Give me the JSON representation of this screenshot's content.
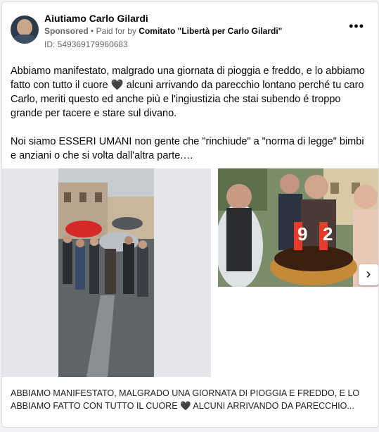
{
  "post": {
    "page_name": "Aiutiamo Carlo Gilardi",
    "sponsored_label": "Sponsored",
    "separator": "•",
    "paid_for_by": "Paid for by",
    "sponsor": "Comitato \"Libertà per Carlo Gilardi\"",
    "ad_id": "ID: 549369179960683",
    "more_icon": "more-options-icon",
    "body_paragraphs": [
      "Abbiamo manifestato, malgrado una giornata di pioggia e freddo, e lo abbiamo fatto con tutto il cuore 🖤 alcuni arrivando da parecchio lontano perché tu caro Carlo, meriti questo ed anche più e l'ingiustizia che stai subendo é troppo grande per tacere e stare sul divano.",
      "Noi siamo ESSERI UMANI non gente che \"rinchiude\" a \"norma di legge\" bimbi e anziani o che si volta dall'altra parte.…"
    ],
    "carousel_next_icon": "chevron-right-icon",
    "caption": "ABBIAMO MANIFESTATO, MALGRADO UNA GIORNATA DI PIOGGIA E FREDDO, E LO ABBIAMO FATTO CON TUTTO IL CUORE 🖤 ALCUNI ARRIVANDO DA PARECCHIO..."
  },
  "photos": [
    {
      "name": "protest-photo"
    },
    {
      "name": "birthday-cake-photo",
      "candle_text": "92"
    }
  ]
}
